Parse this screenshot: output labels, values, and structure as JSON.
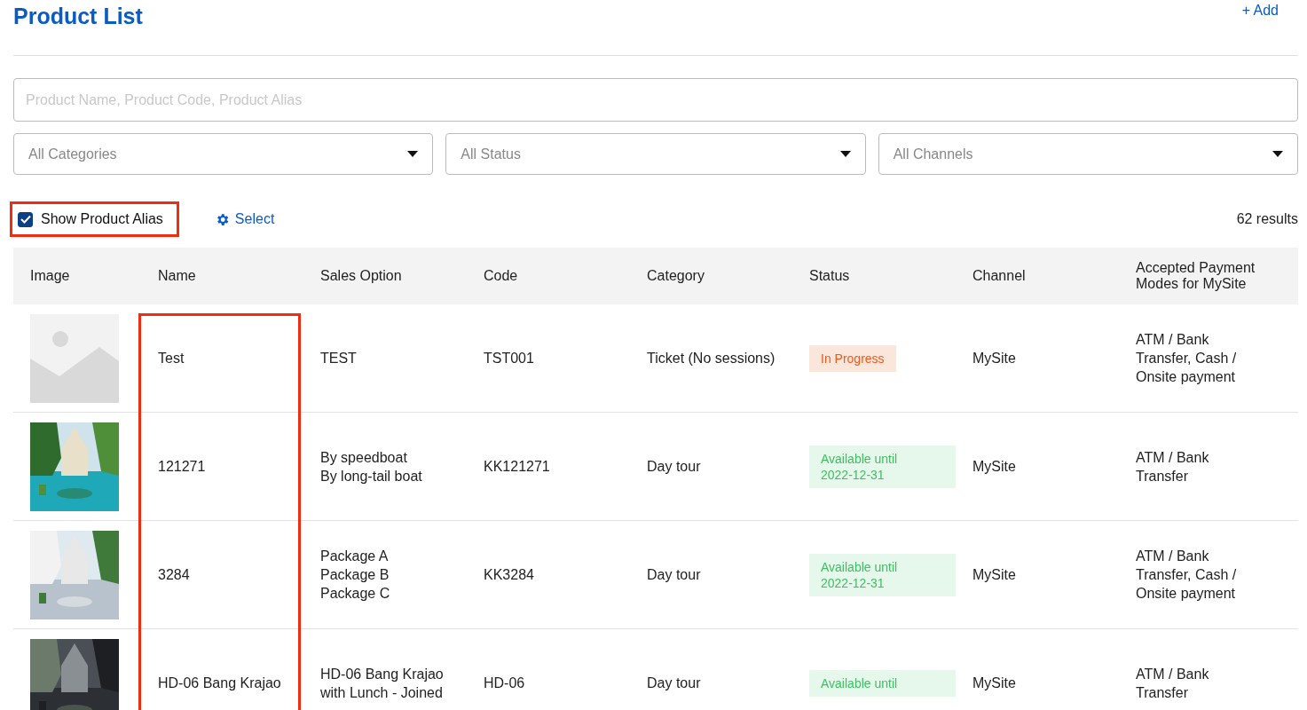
{
  "title": "Product List",
  "add_button": {
    "label": "+ Add"
  },
  "search": {
    "placeholder": "Product Name, Product Code, Product Alias"
  },
  "filters": [
    {
      "placeholder": "All Categories"
    },
    {
      "placeholder": "All Status"
    },
    {
      "placeholder": "All Channels"
    }
  ],
  "show_alias": {
    "label": "Show Product Alias",
    "checked": true,
    "highlighted": true
  },
  "select_button": {
    "label": "Select"
  },
  "results": "62 results",
  "table": {
    "columns": [
      {
        "label": "Image",
        "highlighted": false
      },
      {
        "label": "Name",
        "highlighted": true
      },
      {
        "label": "Sales Option",
        "highlighted": false
      },
      {
        "label": "Code",
        "highlighted": false
      },
      {
        "label": "Category",
        "highlighted": false
      },
      {
        "label": "Status",
        "highlighted": false
      },
      {
        "label": "Channel",
        "highlighted": false
      },
      {
        "label": "Accepted Payment Modes for MySite",
        "highlighted": false
      }
    ],
    "rows": [
      {
        "image": {
          "kind": "placeholder"
        },
        "name": "Test",
        "sales_options": [
          "TEST"
        ],
        "code": "TST001",
        "category": "Ticket (No sessions)",
        "status": {
          "kind": "progress",
          "lines": [
            "In Progress"
          ]
        },
        "channel": "MySite",
        "payment": "ATM / Bank Transfer, Cash / Onsite payment"
      },
      {
        "image": {
          "kind": "picture"
        },
        "name": "121271",
        "sales_options": [
          "By speedboat",
          "By long-tail boat"
        ],
        "code": "KK121271",
        "category": "Day tour",
        "status": {
          "kind": "available",
          "lines": [
            "Available until",
            "2022-12-31"
          ]
        },
        "channel": "MySite",
        "payment": "ATM / Bank Transfer"
      },
      {
        "image": {
          "kind": "picture"
        },
        "name": "3284",
        "sales_options": [
          "Package A",
          "Package B",
          "Package C"
        ],
        "code": "KK3284",
        "category": "Day tour",
        "status": {
          "kind": "available",
          "lines": [
            "Available until",
            "2022-12-31"
          ]
        },
        "channel": "MySite",
        "payment": "ATM / Bank Transfer, Cash / Onsite payment"
      },
      {
        "image": {
          "kind": "picture"
        },
        "name": "HD-06 Bang Krajao",
        "sales_options": [
          "HD-06 Bang Krajao",
          "with Lunch - Joined"
        ],
        "code": "HD-06",
        "category": "Day tour",
        "status": {
          "kind": "available",
          "lines": [
            "Available until"
          ]
        },
        "channel": "MySite",
        "payment": "ATM / Bank Transfer"
      }
    ]
  }
}
